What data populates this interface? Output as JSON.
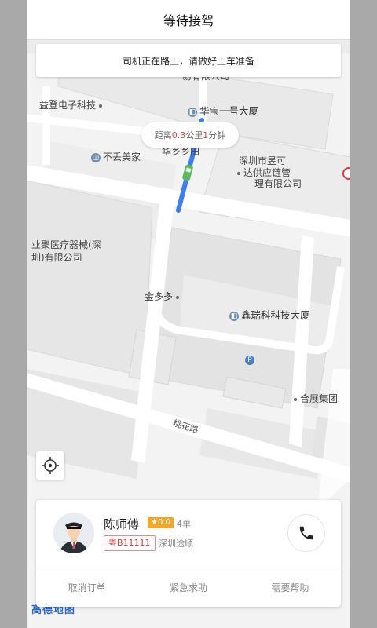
{
  "header": {
    "title": "等待接驾"
  },
  "banner": {
    "text": "司机正在路上，请做好上车准备"
  },
  "distance": {
    "prefix": "距离",
    "km": "0.3",
    "km_unit": "公里",
    "minutes": "1",
    "min_unit": "分钟"
  },
  "map": {
    "pois": [
      {
        "name": "易有限公司"
      },
      {
        "name": "益登电子科技"
      },
      {
        "name": "华宝一号大厦"
      },
      {
        "name": "华乡乡田"
      },
      {
        "name": "不丢美家"
      },
      {
        "name": "深圳市昱可"
      },
      {
        "name": "达供应链管"
      },
      {
        "name": "理有限公司"
      },
      {
        "name": "业聚医疗器械(深"
      },
      {
        "name": "圳)有限公司"
      },
      {
        "name": "金多多"
      },
      {
        "name": "鑫瑞科科技大厦"
      },
      {
        "name": "合展集团"
      }
    ],
    "road": "桃花路",
    "logo": "高德地图",
    "colors": {
      "route": "#3a7ff6",
      "car": "#5cb85c",
      "accent": "#e53935"
    }
  },
  "driver": {
    "name": "陈师傅",
    "rating": "★0.0",
    "orders": "4单",
    "plate": "粤B11111",
    "company": "深圳途顺"
  },
  "actions": {
    "cancel": "取消订单",
    "emergency": "紧急求助",
    "help": "需要帮助"
  },
  "icons": {
    "locate": "crosshair-icon",
    "call": "phone-icon"
  }
}
